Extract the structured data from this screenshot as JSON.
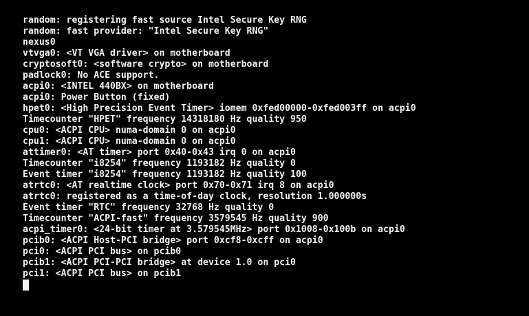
{
  "colors": {
    "background": "#000000",
    "text": "#f2f2f2"
  },
  "console": {
    "lines": [
      "random: registering fast source Intel Secure Key RNG",
      "random: fast provider: \"Intel Secure Key RNG\"",
      "nexus0",
      "vtvga0: <VT VGA driver> on motherboard",
      "cryptosoft0: <software crypto> on motherboard",
      "padlock0: No ACE support.",
      "acpi0: <INTEL 440BX> on motherboard",
      "acpi0: Power Button (fixed)",
      "hpet0: <High Precision Event Timer> iomem 0xfed00000-0xfed003ff on acpi0",
      "Timecounter \"HPET\" frequency 14318180 Hz quality 950",
      "cpu0: <ACPI CPU> numa-domain 0 on acpi0",
      "cpu1: <ACPI CPU> numa-domain 0 on acpi0",
      "attimer0: <AT timer> port 0x40-0x43 irq 0 on acpi0",
      "Timecounter \"i8254\" frequency 1193182 Hz quality 0",
      "Event timer \"i8254\" frequency 1193182 Hz quality 100",
      "atrtc0: <AT realtime clock> port 0x70-0x71 irq 8 on acpi0",
      "atrtc0: registered as a time-of-day clock, resolution 1.000000s",
      "Event timer \"RTC\" frequency 32768 Hz quality 0",
      "Timecounter \"ACPI-fast\" frequency 3579545 Hz quality 900",
      "acpi_timer0: <24-bit timer at 3.579545MHz> port 0x1008-0x100b on acpi0",
      "pcib0: <ACPI Host-PCI bridge> port 0xcf8-0xcff on acpi0",
      "pci0: <ACPI PCI bus> on pcib0",
      "pcib1: <ACPI PCI-PCI bridge> at device 1.0 on pci0",
      "pci1: <ACPI PCI bus> on pcib1"
    ]
  }
}
